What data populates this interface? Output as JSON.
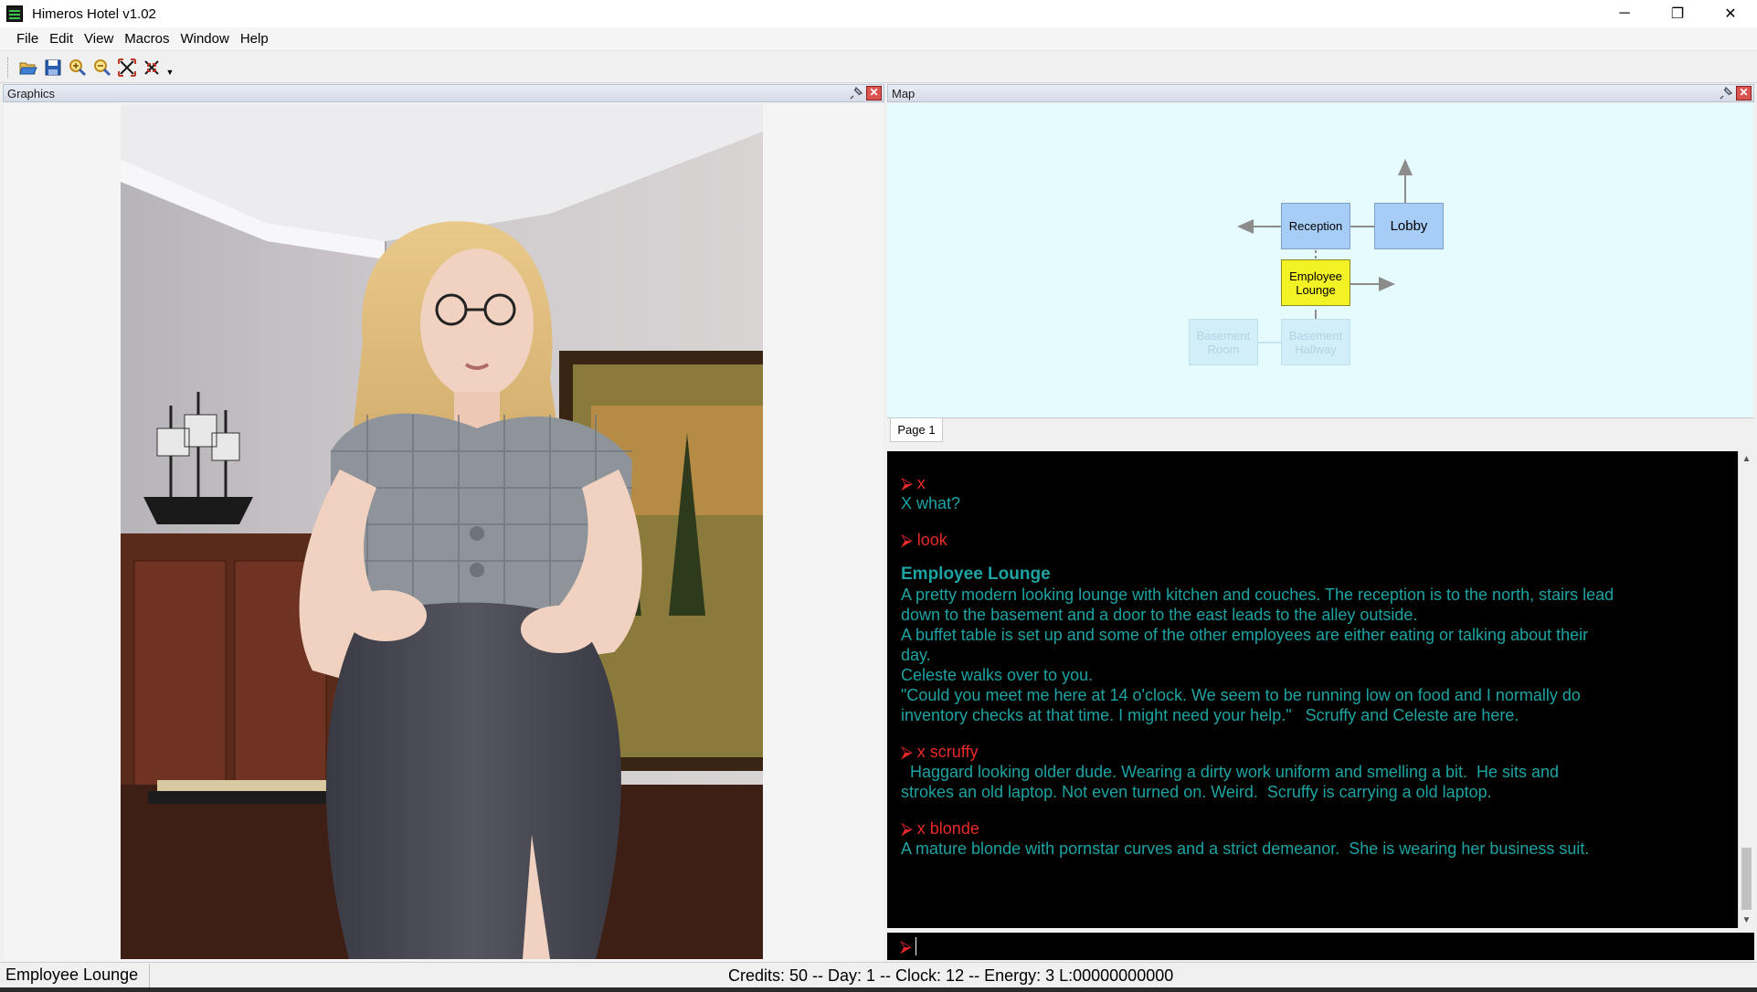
{
  "window": {
    "title": "Himeros Hotel v1.02",
    "minimize": "─",
    "restore": "❐",
    "close": "✕"
  },
  "menu": [
    "File",
    "Edit",
    "View",
    "Macros",
    "Window",
    "Help"
  ],
  "toolbar": {
    "tools": [
      "open-folder-icon",
      "save-disk-icon",
      "zoom-in-icon",
      "zoom-out-icon",
      "fit-to-window-icon",
      "actual-size-icon"
    ],
    "dropdown": "▼"
  },
  "panels": {
    "graphics": {
      "title": "Graphics",
      "close": "✕"
    },
    "map": {
      "title": "Map",
      "close": "✕"
    }
  },
  "map": {
    "page_tab": "Page 1",
    "rooms": {
      "reception": "Reception",
      "lobby": "Lobby",
      "employee_lounge_1": "Employee",
      "employee_lounge_2": "Lounge",
      "basement_room_1": "Basement",
      "basement_room_2": "Room",
      "basement_hallway_1": "Basement",
      "basement_hallway_2": "Hallway"
    },
    "current_room": "Employee Lounge"
  },
  "console": {
    "prompt_glyph": "⮚",
    "lines": {
      "cmd1": "x",
      "resp1": "X what?",
      "cmd2": "look",
      "room_title": "Employee Lounge",
      "desc1": "A pretty modern looking lounge with kitchen and couches. The reception is to the north, stairs lead",
      "desc2": "down to the basement and a door to the east leads to the alley outside.",
      "desc3": "A buffet table is set up and some of the other employees are either eating or talking about their",
      "desc4": "day.",
      "desc5": "Celeste walks over to you.",
      "desc6": "\"Could you meet me here at 14 o'clock. We seem to be running low on food and I normally do",
      "desc7": "inventory checks at that time. I might need your help.\"   Scruffy and Celeste are here.",
      "cmd3": "x scruffy",
      "scruffy1": "  Haggard looking older dude. Wearing a dirty work uniform and smelling a bit.  He sits and",
      "scruffy2": "strokes an old laptop. Not even turned on. Weird.  Scruffy is carrying a old laptop.",
      "cmd4": "x blonde",
      "blonde1": "A mature blonde with pornstar curves and a strict demeanor.  She is wearing her business suit."
    },
    "input_value": ""
  },
  "status": {
    "location": "Employee Lounge",
    "stats": "Credits: 50 -- Day: 1 -- Clock: 12 -- Energy: 3 L:00000000000"
  },
  "colors": {
    "console_bg": "#000000",
    "console_text": "#1ea3a3",
    "command_text": "#ea2a2a",
    "map_bg": "#e6fbfd",
    "current_room": "#f2f224",
    "room": "#a6cdf6"
  }
}
